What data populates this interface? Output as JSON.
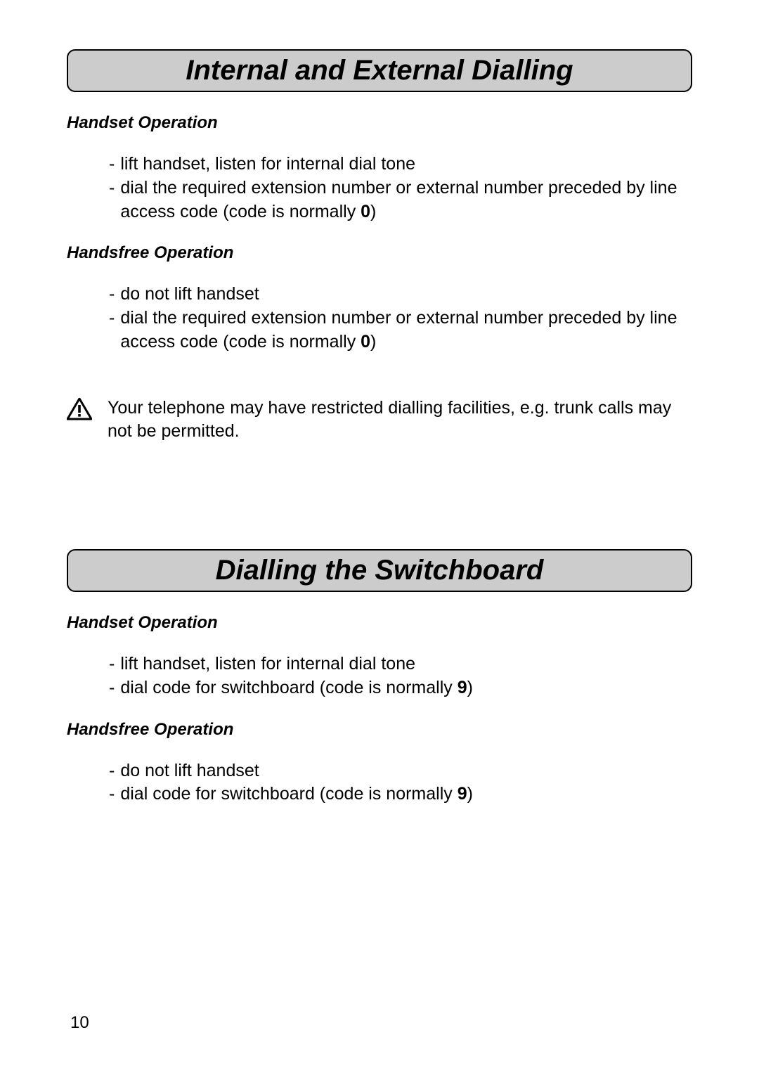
{
  "page_number": "10",
  "section1": {
    "title": "Internal and External Dialling",
    "sub1": {
      "heading": "Handset Operation",
      "items": [
        {
          "text": "lift handset, listen for internal dial tone"
        },
        {
          "text_before": "dial the required extension number or external number preceded by line access code  (code is normally ",
          "bold": "0",
          "text_after": ")"
        }
      ]
    },
    "sub2": {
      "heading": "Handsfree Operation",
      "items": [
        {
          "text": "do not lift handset"
        },
        {
          "text_before": "dial the required extension number or external number preceded by line access code (code is normally ",
          "bold": "0",
          "text_after": ")"
        }
      ]
    },
    "warning": "Your telephone may have restricted dialling facilities, e.g. trunk calls may not be permitted."
  },
  "section2": {
    "title": "Dialling the Switchboard",
    "sub1": {
      "heading": "Handset Operation",
      "items": [
        {
          "text": "lift handset, listen for internal dial tone"
        },
        {
          "text_before": "dial code for switchboard (code is normally ",
          "bold": "9",
          "text_after": ")"
        }
      ]
    },
    "sub2": {
      "heading": "Handsfree Operation",
      "items": [
        {
          "text": "do not lift handset"
        },
        {
          "text_before": "dial code for switchboard (code is normally ",
          "bold": "9",
          "text_after": ")"
        }
      ]
    }
  }
}
